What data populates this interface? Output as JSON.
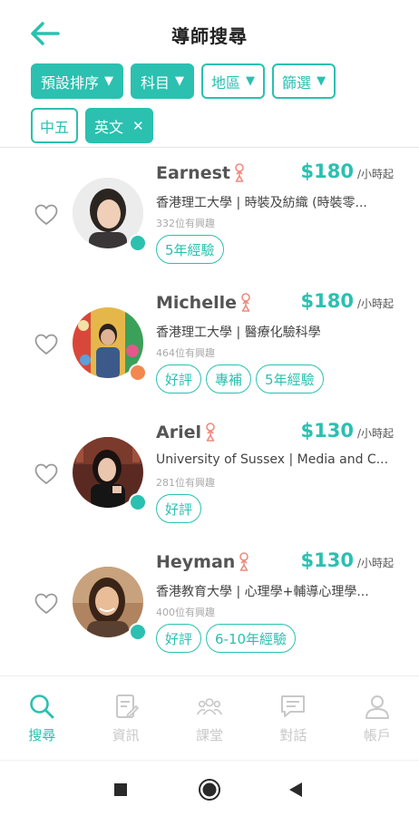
{
  "header": {
    "title": "導師搜尋"
  },
  "filters": {
    "row1": [
      {
        "label": "預設排序",
        "filled": true
      },
      {
        "label": "科目",
        "filled": true
      },
      {
        "label": "地區",
        "filled": false
      },
      {
        "label": "篩選",
        "filled": false
      }
    ],
    "caret": "▼",
    "row2": [
      {
        "label": "中五",
        "filled": false,
        "removable": false
      },
      {
        "label": "英文",
        "filled": true,
        "removable": true
      }
    ],
    "remove_glyph": "✕"
  },
  "tutors": [
    {
      "name": "Earnest",
      "price": "$180",
      "unit": "/小時起",
      "school": "香港理工大學 | 時裝及紡織 (時裝零...",
      "interest": "332位有興趣",
      "tags": [
        "5年經驗"
      ],
      "status_color": "#2bc0b0"
    },
    {
      "name": "Michelle",
      "price": "$180",
      "unit": "/小時起",
      "school": "香港理工大學 | 醫療化驗科學",
      "interest": "464位有興趣",
      "tags": [
        "好評",
        "專補",
        "5年經驗"
      ],
      "status_color": "#f2884f"
    },
    {
      "name": "Ariel",
      "price": "$130",
      "unit": "/小時起",
      "school": "University of Sussex | Media and C...",
      "interest": "281位有興趣",
      "tags": [
        "好評"
      ],
      "status_color": "#2bc0b0"
    },
    {
      "name": "Heyman",
      "price": "$130",
      "unit": "/小時起",
      "school": "香港教育大學 | 心理學+輔導心理學...",
      "interest": "400位有興趣",
      "tags": [
        "好評",
        "6-10年經驗"
      ],
      "status_color": "#2bc0b0"
    }
  ],
  "nav": [
    {
      "label": "搜尋",
      "icon": "search-icon",
      "active": true
    },
    {
      "label": "資訊",
      "icon": "document-edit-icon",
      "active": false
    },
    {
      "label": "課堂",
      "icon": "group-icon",
      "active": false
    },
    {
      "label": "對話",
      "icon": "chat-icon",
      "active": false
    },
    {
      "label": "帳戶",
      "icon": "user-icon",
      "active": false
    }
  ],
  "colors": {
    "accent": "#2bc0b0",
    "gender": "#f08a7e",
    "nav_inactive": "#c8c8c8",
    "status_orange": "#f2884f"
  }
}
